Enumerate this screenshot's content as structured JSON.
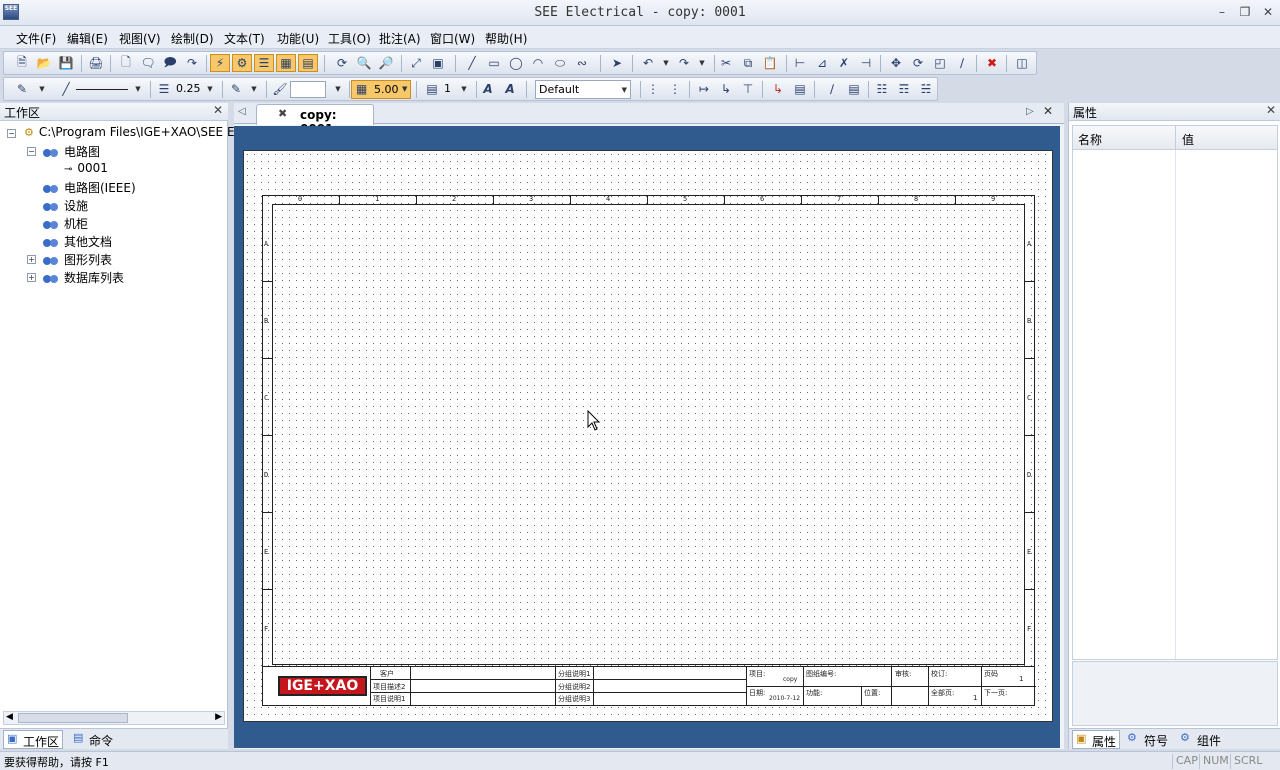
{
  "window": {
    "title": "SEE Electrical - copy: 0001",
    "app_icon_text": "SEE"
  },
  "menu": [
    "文件(F)",
    "编辑(E)",
    "视图(V)",
    "绘制(D)",
    "文本(T)",
    "功能(U)",
    "工具(O)",
    "批注(A)",
    "窗口(W)",
    "帮助(H)"
  ],
  "format_toolbar": {
    "line_width": "0.25",
    "grid_size": "5.00",
    "layer": "1",
    "style_select": "Default"
  },
  "workspace": {
    "title": "工作区",
    "tree": {
      "root": "C:\\Program Files\\IGE+XAO\\SEE E",
      "circuit": "电路图",
      "page": "0001",
      "circuit_ieee": "电路图(IEEE)",
      "facility": "设施",
      "cabinet": "机柜",
      "other_docs": "其他文档",
      "graphic_list": "图形列表",
      "database_list": "数据库列表"
    },
    "tabs": {
      "workspace": "工作区",
      "command": "命令"
    }
  },
  "document_tab": {
    "label": "copy: 0001"
  },
  "drawing": {
    "columns": [
      "0",
      "1",
      "2",
      "3",
      "4",
      "5",
      "6",
      "7",
      "8",
      "9"
    ],
    "rows": [
      "A",
      "B",
      "C",
      "D",
      "E",
      "F"
    ],
    "logo": "IGE+XAO",
    "title_block": {
      "client": "客户",
      "project_desc2": "项目描述2",
      "project_desc1": "项目说明1",
      "path_desc1": "分组说明1",
      "path_desc2": "分组说明2",
      "path_desc3": "分组说明3",
      "project_label": "项目:",
      "project_value": "copy",
      "drawing_no": "图纸编号:",
      "approved": "审核:",
      "checked": "校订:",
      "page_label": "页码",
      "page_value": "1",
      "date_label": "日期:",
      "date_value": "2010-7-12",
      "function": "功能:",
      "location": "位置:",
      "total_pages": "全部页:",
      "total_value": "1",
      "next_page": "下一页:"
    }
  },
  "properties": {
    "title": "属性",
    "col_name": "名称",
    "col_value": "值",
    "tabs": {
      "properties": "属性",
      "symbol": "符号",
      "component": "组件"
    }
  },
  "status": {
    "help": "要获得帮助，请按 F1",
    "cap": "CAP",
    "num": "NUM",
    "scrl": "SCRL"
  }
}
